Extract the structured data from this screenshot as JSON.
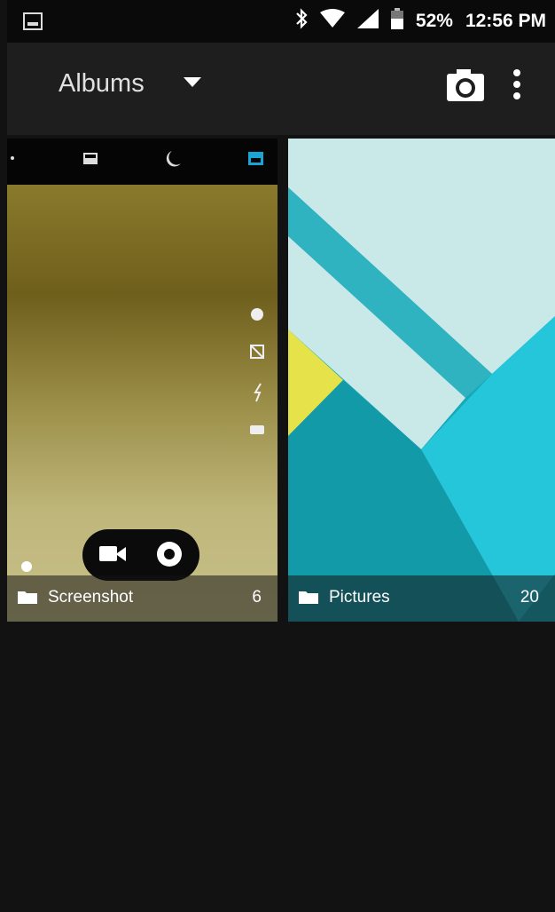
{
  "statusbar": {
    "battery": "52%",
    "time": "12:56 PM",
    "icons": [
      "image-notification-icon",
      "bluetooth-icon",
      "wifi-icon",
      "signal-icon",
      "battery-icon"
    ]
  },
  "appbar": {
    "title": "Albums",
    "icons": [
      "dropdown-arrow-icon",
      "camera-icon",
      "more-vert-icon"
    ]
  },
  "albums": [
    {
      "name": "Screenshot",
      "count": "6",
      "thumbnail": "camera-app-screenshot"
    },
    {
      "name": "Pictures",
      "count": "20",
      "thumbnail": "material-wallpaper"
    }
  ],
  "colors": {
    "background": "#121212",
    "appbar": "#1e1e1e",
    "accent": "#1ca3d6",
    "teal": "#17a8b8",
    "cyan": "#26c6da",
    "light_teal": "#c9e9e9",
    "yellow": "#e6e34a"
  }
}
